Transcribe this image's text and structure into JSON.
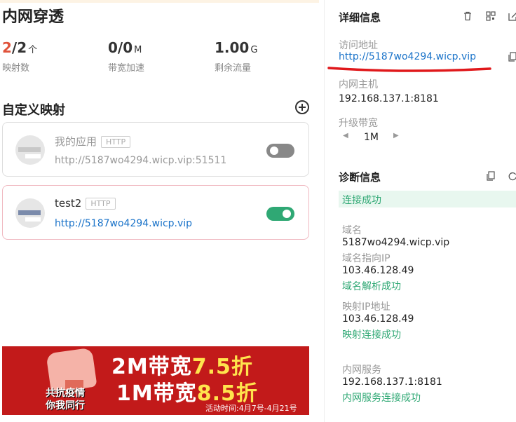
{
  "left": {
    "title": "内网穿透",
    "stats": [
      {
        "value_red": "2",
        "value_rest": "/2",
        "unit": "个",
        "label": "映射数"
      },
      {
        "value_red": "",
        "value_rest": "0/0",
        "unit": "M",
        "label": "带宽加速"
      },
      {
        "value_red": "",
        "value_rest": "1.00",
        "unit": "G",
        "label": "剩余流量"
      }
    ],
    "section_title": "自定义映射",
    "mappings": [
      {
        "name": "我的应用",
        "protocol": "HTTP",
        "url": "http://5187wo4294.wicp.vip:51511",
        "enabled": false
      },
      {
        "name": "test2",
        "protocol": "HTTP",
        "url": "http://5187wo4294.wicp.vip",
        "enabled": true
      }
    ],
    "banner": {
      "slogan_line1": "共抗疫情",
      "slogan_line2": "你我同行",
      "line1_a": "2M带宽",
      "line1_b": "7.5折",
      "line2_a": "1M带宽",
      "line2_b": "8.5折",
      "date": "活动时间:4月7号-4月21号"
    }
  },
  "right": {
    "details_title": "详细信息",
    "access_label": "访问地址",
    "access_url": "http://5187wo4294.wicp.vip",
    "host_label": "内网主机",
    "host_value": "192.168.137.1:8181",
    "upgrade_label": "升级带宽",
    "bandwidth_value": "1M",
    "diag_title": "诊断信息",
    "diag_status": "连接成功",
    "domain_label": "域名",
    "domain_value": "5187wo4294.wicp.vip",
    "domain_ip_label": "域名指向IP",
    "domain_ip_value": "103.46.128.49",
    "domain_ip_status": "域名解析成功",
    "mapped_ip_label": "映射IP地址",
    "mapped_ip_value": "103.46.128.49",
    "mapped_ip_status": "映射连接成功",
    "lan_label": "内网服务",
    "lan_value": "192.168.137.1:8181",
    "lan_status": "内网服务连接成功"
  },
  "colors": {
    "accent_red": "#e0533b",
    "link_blue": "#1a73c9",
    "success_green": "#2fa874",
    "banner_red": "#c21a1a"
  }
}
